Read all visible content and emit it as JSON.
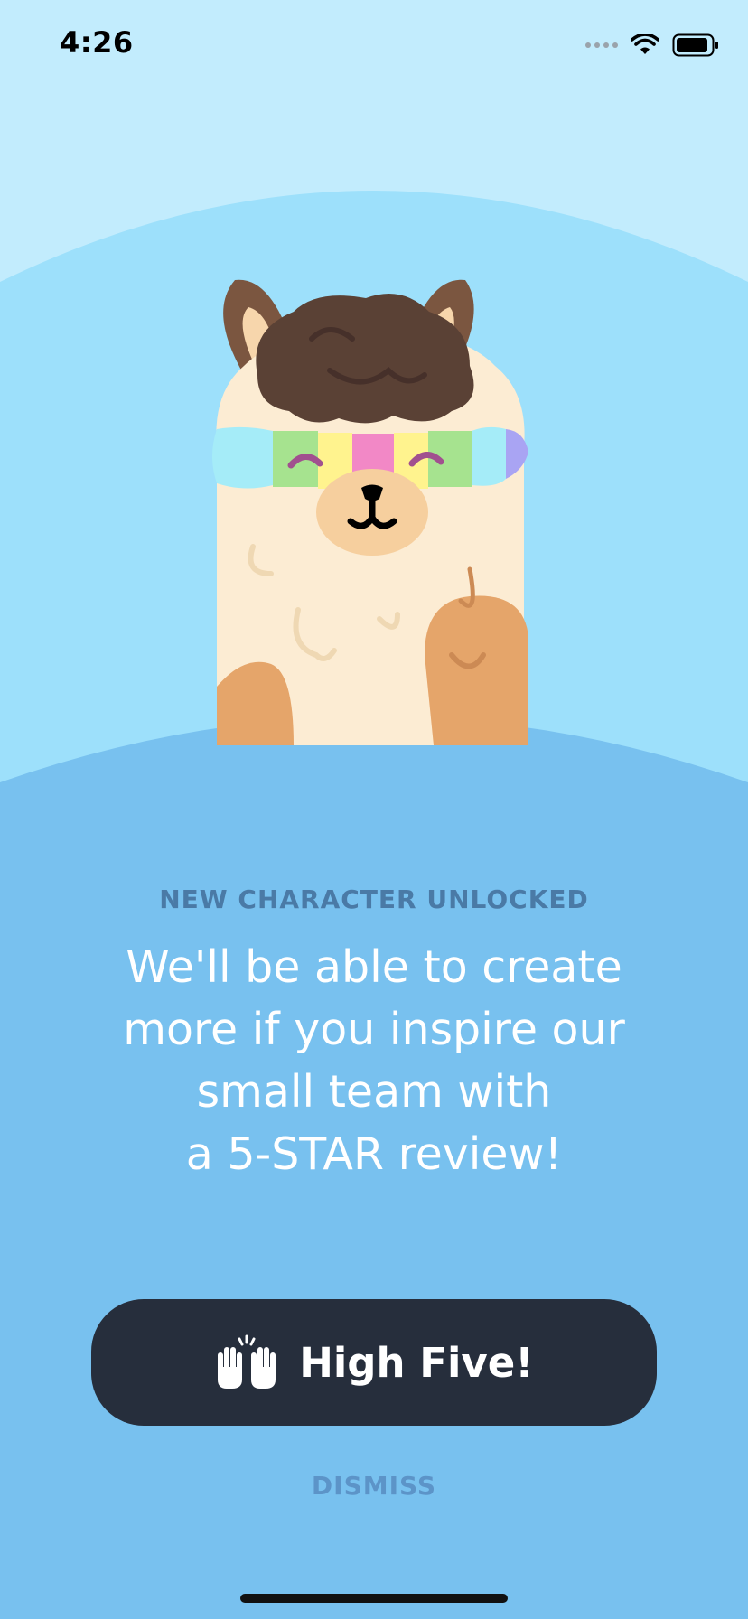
{
  "status_bar": {
    "time": "4:26"
  },
  "modal": {
    "eyebrow": "NEW CHARACTER UNLOCKED",
    "headline_lines": [
      "We'll be able to create",
      "more if you inspire our",
      "small team with",
      "a 5-STAR review!"
    ],
    "primary_button": {
      "icon": "raised-hands-icon",
      "label": "High Five!"
    },
    "dismiss_label": "DISMISS"
  },
  "colors": {
    "sky": "#c2ecfd",
    "arc_light": "#9de0fb",
    "panel": "#78c1ef",
    "button": "#262e3c",
    "eyebrow": "#4a7aa6",
    "dismiss": "#5c94c8"
  }
}
